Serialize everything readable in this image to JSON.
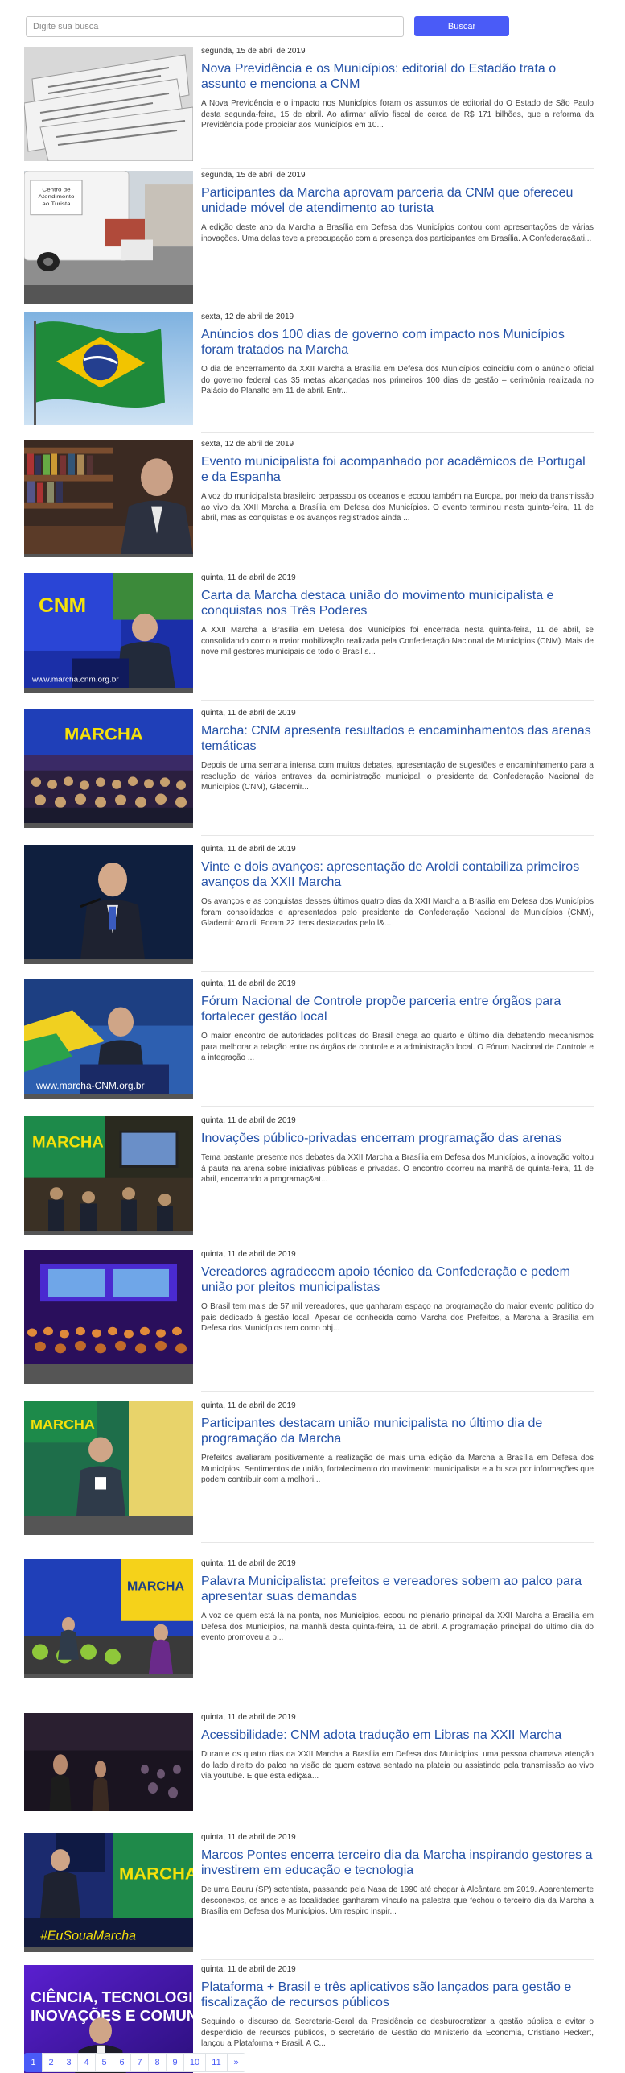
{
  "search": {
    "placeholder": "Digite sua busca",
    "button_label": "Buscar"
  },
  "accent_color": "#4a5bf7",
  "link_color": "#2552a8",
  "articles": [
    {
      "date": "segunda, 15 de abril de 2019",
      "title": "Nova Previdência e os Municípios: editorial do Estadão trata o assunto e menciona a CNM",
      "excerpt": "A Nova Previdência e o impacto nos Municípios foram os assuntos de editorial do O Estado de São Paulo desta segunda-feira, 15 de abril. Ao afirmar alívio fiscal de cerca de R$ 171 bilhões, que a reforma da Previdência pode propiciar aos Municípios em 10...",
      "image": "newspapers-photo",
      "image_text": ""
    },
    {
      "date": "segunda, 15 de abril de 2019",
      "title": "Participantes da Marcha aprovam parceria da CNM que ofereceu unidade móvel de atendimento ao turista",
      "excerpt": "A edição deste ano da Marcha a Brasília em Defesa dos Municípios contou com apresentações de várias inovações. Uma delas teve a preocupação com a presença dos participantes em Brasília. A Confederaç&ati...",
      "image": "tourist-van-photo",
      "image_text": "Centro de Atendimento ao Turista"
    },
    {
      "date": "sexta, 12 de abril de 2019",
      "title": "Anúncios dos 100 dias de governo com impacto nos Municípios foram tratados na Marcha",
      "excerpt": "O dia de encerramento da XXII Marcha a Brasília em Defesa dos Municípios coincidiu com o anúncio oficial do governo federal das 35 metas alcançadas nos primeiros 100 dias de gestão – cerimônia realizada no Palácio do Planalto em 11 de abril. Entr...",
      "image": "brazil-flag-photo",
      "image_text": ""
    },
    {
      "date": "sexta, 12 de abril de 2019",
      "title": "Evento municipalista foi acompanhado por acadêmicos de Portugal e da Espanha",
      "excerpt": "A voz do municipalista brasileiro perpassou os oceanos e ecoou também na Europa, por meio da transmissão ao vivo da XXII Marcha a Brasília em Defesa dos Municípios. O evento terminou nesta quinta-feira, 11 de abril, mas as conquistas e os avanços registrados ainda ...",
      "image": "academic-office-photo",
      "image_text": ""
    },
    {
      "date": "quinta, 11 de abril de 2019",
      "title": "Carta da Marcha destaca união do movimento municipalista e conquistas nos Três Poderes",
      "excerpt": "A XXII Marcha a Brasília em Defesa dos Municípios foi encerrada nesta quinta-feira, 11 de abril, se consolidando como a maior mobilização realizada pela Confederação Nacional de Municípios (CNM). Mais de nove mil gestores municipais de todo o Brasil s...",
      "image": "stage-speaker-photo",
      "image_text": "www.marcha.cnm.org.br"
    },
    {
      "date": "quinta, 11 de abril de 2019",
      "title": "Marcha: CNM apresenta resultados e encaminhamentos das arenas temáticas",
      "excerpt": "Depois de uma semana intensa com muitos debates, apresentação de sugestões e encaminhamento para a resolução de vários entraves da administração municipal, o presidente da Confederação Nacional de Municípios (CNM), Glademir...",
      "image": "auditorium-photo",
      "image_text": "MARCHA"
    },
    {
      "date": "quinta, 11 de abril de 2019",
      "title": "Vinte e dois avanços: apresentação de Aroldi contabiliza primeiros avanços da XXII Marcha",
      "excerpt": "Os avanços e as conquistas desses últimos quatro dias da XXII Marcha a Brasília em Defesa dos Municípios foram consolidados e apresentados pelo presidente da Confederação Nacional de Municípios (CNM), Glademir Aroldi. Foram 22 itens destacados pelo l&...",
      "image": "speaker-blue-photo",
      "image_text": ""
    },
    {
      "date": "quinta, 11 de abril de 2019",
      "title": "Fórum Nacional de Controle propõe parceria entre órgãos para fortalecer gestão local",
      "excerpt": "O maior encontro de autoridades políticas do Brasil chega ao quarto e último dia debatendo mecanismos para melhorar a relação entre os órgãos de controle e a administração local. O Fórum Nacional de Controle e a integração ...",
      "image": "podium-speaker-photo",
      "image_text": "www.marcha-CNM.org.br"
    },
    {
      "date": "quinta, 11 de abril de 2019",
      "title": "Inovações público-privadas encerram programação das arenas",
      "excerpt": "Tema bastante presente nos debates da XXII Marcha a Brasília em Defesa dos Municípios, a inovação voltou à pauta na arena sobre iniciativas públicas e privadas. O encontro ocorreu na manhã de quinta-feira, 11 de abril, encerrando a programaç&at...",
      "image": "arena-photo",
      "image_text": "MARCHA"
    },
    {
      "date": "quinta, 11 de abril de 2019",
      "title": "Vereadores agradecem apoio técnico da Confederação e pedem união por pleitos municipalistas",
      "excerpt": "O Brasil tem mais de 57 mil vereadores, que ganharam espaço na programação do maior evento político do país dedicado à gestão local. Apesar de conhecida como Marcha dos Prefeitos, a Marcha a Brasília em Defesa dos Municípios tem como obj...",
      "image": "crowd-purple-photo",
      "image_text": ""
    },
    {
      "date": "quinta, 11 de abril de 2019",
      "title": "Participantes destacam união municipalista no último dia de programação da Marcha",
      "excerpt": "Prefeitos avaliaram positivamente a realização de mais uma edição da Marcha a Brasília em Defesa dos Municípios. Sentimentos de união, fortalecimento do movimento municipalista e a busca por informações que podem contribuir com a melhori...",
      "image": "participant-photo",
      "image_text": "MARCHA"
    },
    {
      "date": "quinta, 11 de abril de 2019",
      "title": "Palavra Municipalista: prefeitos e vereadores sobem ao palco para apresentar suas demandas",
      "excerpt": "A voz de quem está lá na ponta, nos Municípios, ecoou no plenário principal da XXII Marcha a Brasília em Defesa dos Municípios, na manhã desta quinta-feira, 11 de abril. A programação principal do último dia do evento promoveu a p...",
      "image": "stage-yellow-photo",
      "image_text": "MARCHA"
    },
    {
      "date": "quinta, 11 de abril de 2019",
      "title": "Acessibilidade: CNM adota tradução em Libras na XXII Marcha",
      "excerpt": "Durante os quatro dias da XXII Marcha a Brasília em Defesa dos Municípios, uma pessoa chamava atenção do lado direito do palco na visão de quem estava sentado na plateia ou assistindo pela transmissão ao vivo via youtube. E que esta ediç&a...",
      "image": "libras-photo",
      "image_text": ""
    },
    {
      "date": "quinta, 11 de abril de 2019",
      "title": "Marcos Pontes encerra terceiro dia da Marcha inspirando gestores a investirem em educação e tecnologia",
      "excerpt": "De uma Bauru (SP) setentista, passando pela Nasa de 1990 até chegar à Alcântara em 2019. Aparentemente desconexos, os anos e as localidades ganharam vínculo na palestra que fechou o terceiro dia da Marcha a Brasília em Defesa dos Municípios. Um respiro inspir...",
      "image": "pontes-stage-photo",
      "image_text": "MARCHA"
    },
    {
      "date": "quinta, 11 de abril de 2019",
      "title": "Plataforma + Brasil e três aplicativos são lançados para gestão e fiscalização de recursos públicos",
      "excerpt": "Seguindo o discurso da Secretaria-Geral da Presidência de desburocratizar a gestão pública e evitar o desperdício de recursos públicos, o secretário de Gestão do Ministério da Economia, Cristiano Heckert, lançou a Plataforma + Brasil. A C...",
      "image": "innovation-stage-photo",
      "image_text": "CIÊNCIA, TECNOLOGIA, INOVAÇÕES E COMUNICAÇÕES"
    }
  ],
  "pagination": {
    "pages": [
      "1",
      "2",
      "3",
      "4",
      "5",
      "6",
      "7",
      "8",
      "9",
      "10",
      "11"
    ],
    "next_label": "»",
    "current": "1"
  }
}
